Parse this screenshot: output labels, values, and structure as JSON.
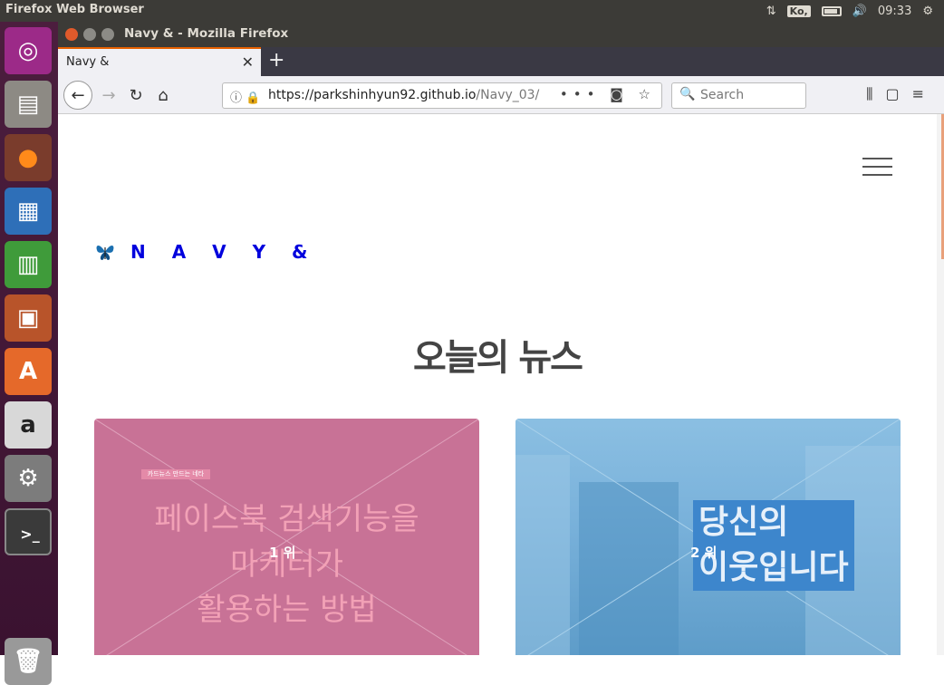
{
  "system": {
    "app_title": "Firefox Web Browser",
    "keyboard": "Ko,",
    "time": "09:33"
  },
  "window": {
    "title": "Navy & - Mozilla Firefox"
  },
  "tab": {
    "label": "Navy &"
  },
  "navbar": {
    "url_main": "https://parkshinhyun92.github.io",
    "url_path": "/Navy_03/",
    "search_placeholder": "Search"
  },
  "page": {
    "brand": "N A V Y  &",
    "heading": "오늘의 뉴스",
    "cards": [
      {
        "rank": "1 위",
        "tag": "카드뉴스 만드는 네타",
        "title": "페이스북 검색기능을\n마케터가\n활용하는 방법"
      },
      {
        "rank": "2 위",
        "title": "당신의\n이웃입니다"
      }
    ]
  },
  "colors": {
    "brand": "#0000dd",
    "card1": "#c87296",
    "card2": "#6aaad6",
    "tab_accent": "#e66000"
  }
}
